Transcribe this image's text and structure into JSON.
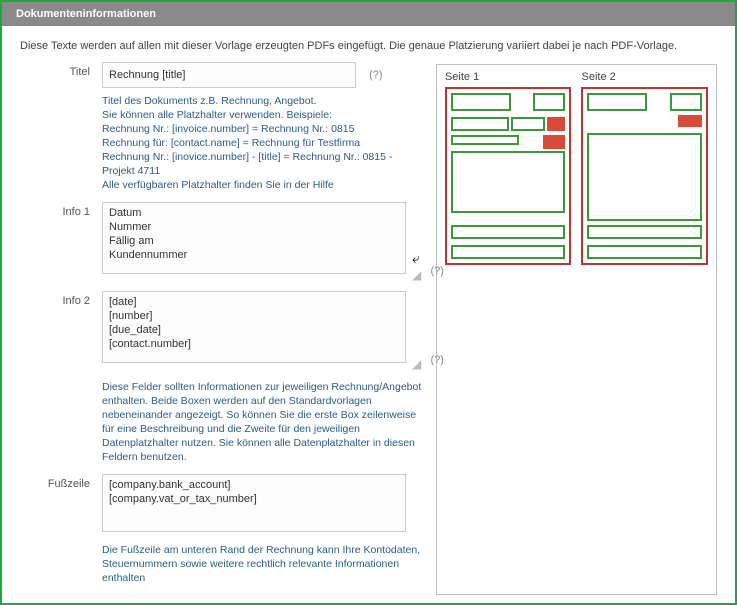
{
  "header": {
    "title": "Dokumenteninformationen"
  },
  "intro": "Diese Texte werden auf allen mit dieser Vorlage erzeugten PDFs eingefügt. Die genaue Platzierung variiert dabei je nach PDF-Vorlage.",
  "labels": {
    "titel": "Titel",
    "info1": "Info 1",
    "info2": "Info 2",
    "fusszeile": "Fußzeile"
  },
  "titel": {
    "value": "Rechnung [title]",
    "help": "(?)",
    "hint": "Titel des Dokuments z.B. Rechnung, Angebot.\nSie können alle Platzhalter verwenden. Beispiele:\nRechnung Nr.: [invoice.number] = Rechnung Nr.: 0815\nRechnung für: [contact.name] = Rechnung für Testfirma\nRechnung Nr.: [inovice.number] - [title] = Rechnung Nr.: 0815 - Projekt 4711\nAlle verfügbaren Platzhalter finden Sie in der Hilfe"
  },
  "info1": {
    "value": "Datum\nNummer\nFällig am\nKundennummer",
    "help": "(?)"
  },
  "info2": {
    "value": "[date]\n[number]\n[due_date]\n[contact.number]",
    "help": "(?)"
  },
  "info_hint": "Diese Felder sollten Informationen zur jeweiligen Rechnung/Angebot enthalten. Beide Boxen werden auf den Standardvorlagen nebeneinander angezeigt. So können Sie die erste Box zeilenweise für eine Beschreibung und die Zweite für den jeweiligen Datenplatzhalter nutzen. Sie können alle Datenplatzhalter in diesen Feldern benutzen.",
  "fusszeile": {
    "value": "[company.bank_account]\n[company.vat_or_tax_number]"
  },
  "foot_hint": "Die Fußzeile am unteren Rand der Rechnung kann Ihre Kontodaten, Steuernummern sowie weitere rechtlich relevante Informationen enthalten",
  "preview": {
    "seite1": "Seite 1",
    "seite2": "Seite 2"
  }
}
